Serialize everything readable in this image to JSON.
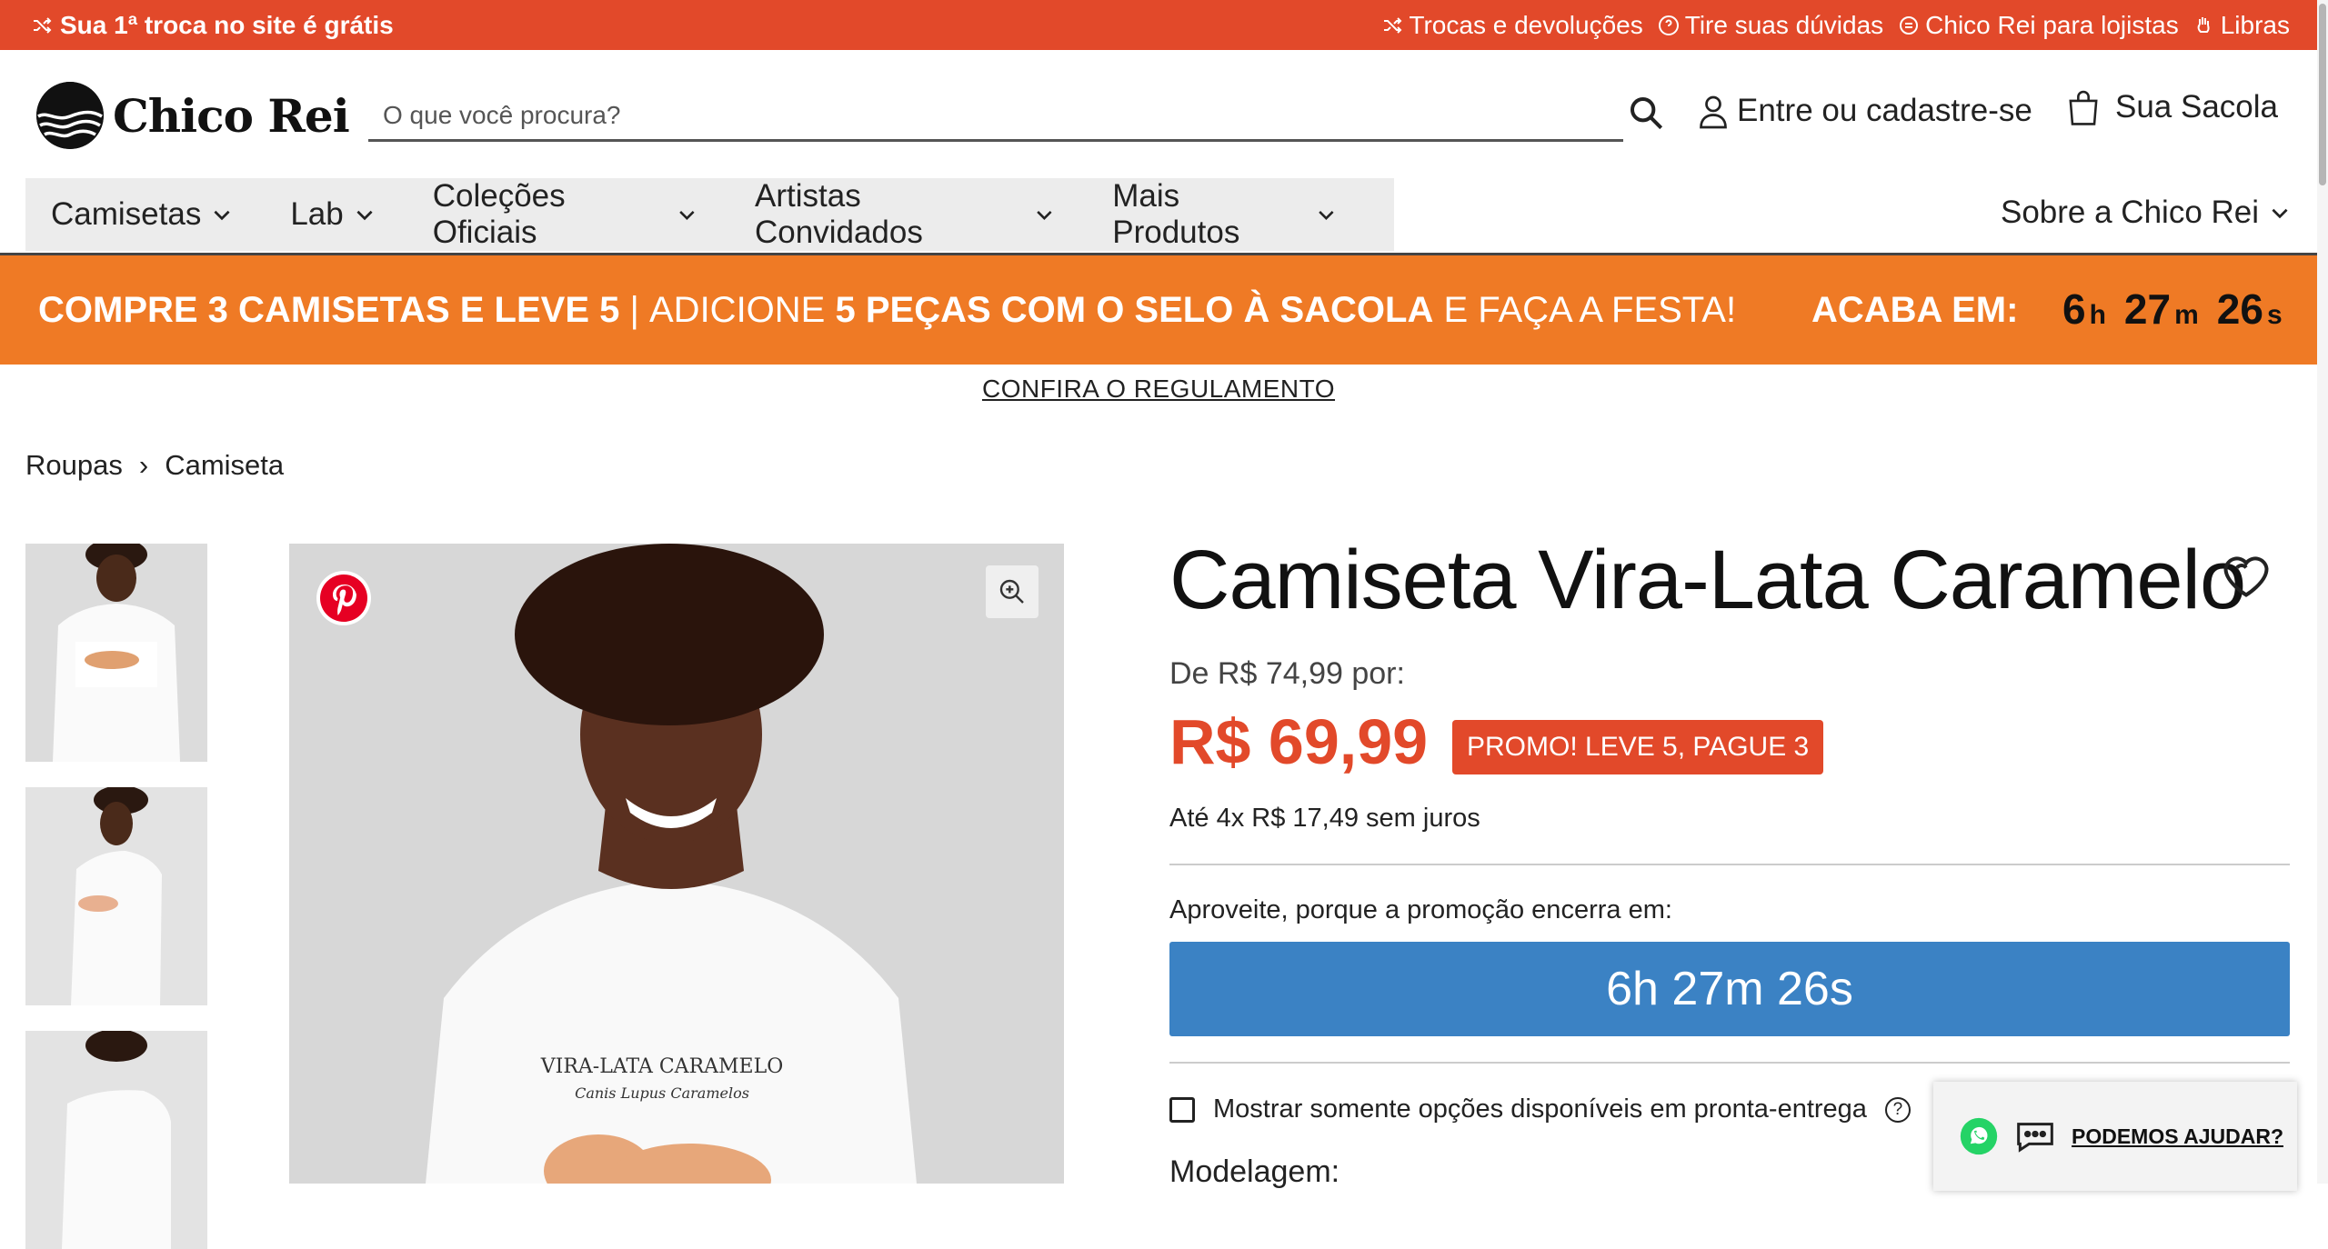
{
  "topbar": {
    "promo": "Sua 1ª troca no site é grátis",
    "links": [
      "Trocas e devoluções",
      "Tire suas dúvidas",
      "Chico Rei para lojistas",
      "Libras"
    ]
  },
  "header": {
    "logo_text": "Chico Rei",
    "search_placeholder": "O que você procura?",
    "login_label": "Entre ou cadastre-se",
    "bag_label": "Sua Sacola"
  },
  "nav": {
    "items": [
      "Camisetas",
      "Lab",
      "Coleções Oficiais",
      "Artistas Convidados",
      "Mais Produtos"
    ],
    "about": "Sobre a Chico Rei"
  },
  "banner": {
    "part1": "COMPRE 3 CAMISETAS E LEVE 5",
    "sep": " | ",
    "part2": "ADICIONE ",
    "part3": "5 PEÇAS COM O SELO À SACOLA",
    "part4": " E FAÇA A FESTA!",
    "ends_label": "ACABA EM:",
    "timer": {
      "h": "6",
      "h_unit": "h",
      "m": "27",
      "m_unit": "m",
      "s": "26",
      "s_unit": "s"
    }
  },
  "regulation_link": "CONFIRA O REGULAMENTO",
  "breadcrumb": [
    "Roupas",
    "Camiseta"
  ],
  "breadcrumb_sep": "›",
  "product": {
    "title": "Camiseta Vira-Lata Caramelo",
    "old_price_text": "De R$ 74,99 por:",
    "price": "R$ 69,99",
    "promo_badge": "PROMO! LEVE 5, PAGUE 3",
    "installments": "Até 4x R$ 17,49 sem juros",
    "promo_ends_text": "Aproveite, porque a promoção encerra em:",
    "countdown": "6h 27m 26s",
    "availability_checkbox": "Mostrar somente opções disponíveis em pronta-entrega",
    "modeling_label": "Modelagem:"
  },
  "shirt_print": {
    "line1": "VIRA-LATA CARAMELO",
    "line2": "Canis Lupus Caramelos"
  },
  "help_widget": {
    "label": "PODEMOS AJUDAR?"
  },
  "colors": {
    "accent": "#e2492a",
    "banner": "#ef7a25",
    "countdown": "#3b82c4"
  }
}
